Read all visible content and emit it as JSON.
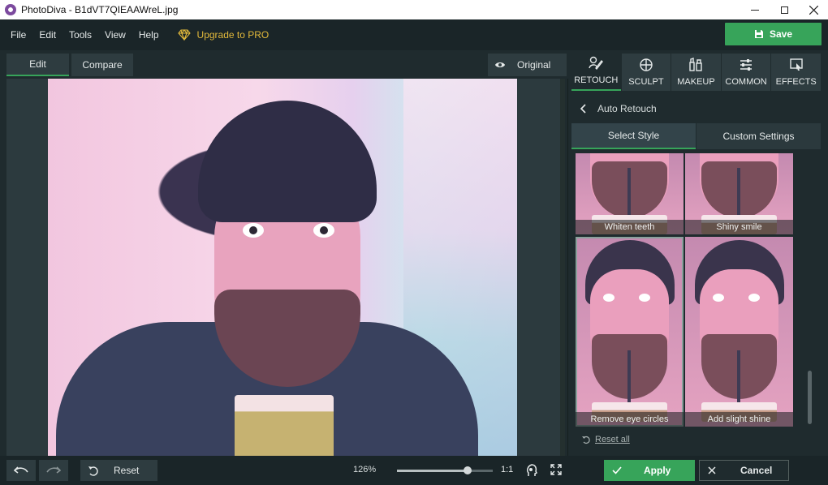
{
  "window": {
    "title": "PhotoDiva - B1dVT7QIEAAWreL.jpg"
  },
  "menu": {
    "items": [
      "File",
      "Edit",
      "Tools",
      "View",
      "Help"
    ],
    "upgrade_label": "Upgrade to PRO",
    "save_label": "Save"
  },
  "view_tabs": {
    "edit": "Edit",
    "compare": "Compare",
    "original": "Original"
  },
  "tool_tabs": [
    {
      "label": "RETOUCH",
      "icon": "retouch-icon",
      "active": true
    },
    {
      "label": "SCULPT",
      "icon": "sculpt-icon",
      "active": false
    },
    {
      "label": "MAKEUP",
      "icon": "makeup-icon",
      "active": false
    },
    {
      "label": "COMMON",
      "icon": "sliders-icon",
      "active": false
    },
    {
      "label": "EFFECTS",
      "icon": "effects-icon",
      "active": false
    }
  ],
  "panel": {
    "section_title": "Auto Retouch",
    "style_tabs": {
      "select_style": "Select Style",
      "custom_settings": "Custom Settings"
    },
    "thumbnails": [
      {
        "label": "Whiten teeth",
        "selected": false
      },
      {
        "label": "Shiny smile",
        "selected": false
      },
      {
        "label": "Remove eye circles",
        "selected": true
      },
      {
        "label": "Add slight shine",
        "selected": false
      }
    ],
    "reset_all": "Reset all",
    "scroll_position": 0.88
  },
  "bottom": {
    "reset_label": "Reset",
    "zoom_label": "126%",
    "zoom_slider": 0.74,
    "one_to_one": "1:1",
    "apply_label": "Apply",
    "cancel_label": "Cancel"
  },
  "colors": {
    "accent": "#37a45a",
    "upgrade": "#e2b93b",
    "background": "#1f2b2e"
  }
}
